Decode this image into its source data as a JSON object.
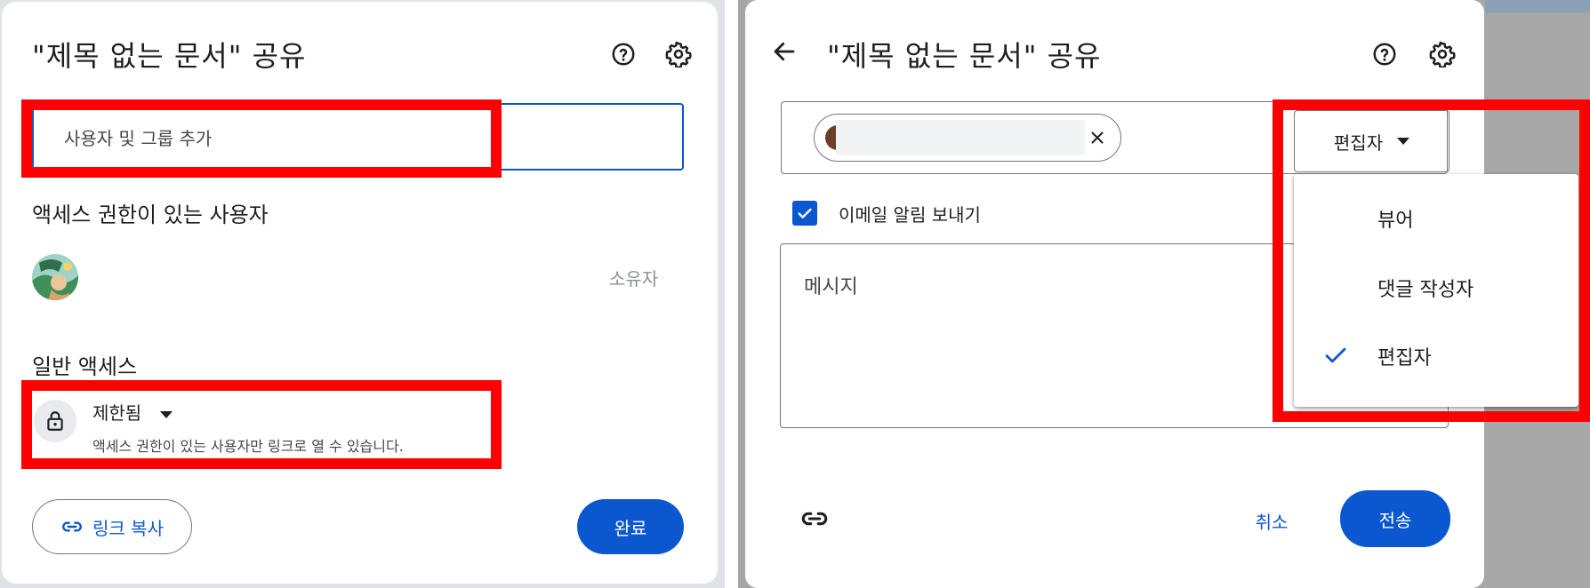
{
  "left_dialog": {
    "title": "\"제목 없는 문서\" 공유",
    "help_icon": "help-icon",
    "settings_icon": "gear-icon",
    "add_people_placeholder": "사용자 및 그룹 추가",
    "people_with_access_label": "액세스 권한이 있는 사용자",
    "owner": {
      "role": "소유자"
    },
    "general_access_label": "일반 액세스",
    "general_access": {
      "value": "제한됨",
      "description": "액세스 권한이 있는 사용자만 링크로 열 수 있습니다."
    },
    "copy_link_label": "링크 복사",
    "done_label": "완료"
  },
  "right_dialog": {
    "title": "\"제목 없는 문서\" 공유",
    "back_icon": "arrow-left-icon",
    "role_selected": "편집자",
    "notify_checkbox": {
      "label": "이메일 알림 보내기",
      "checked": true
    },
    "message_placeholder": "메시지",
    "role_menu": [
      {
        "label": "뷰어",
        "selected": false
      },
      {
        "label": "댓글 작성자",
        "selected": false
      },
      {
        "label": "편집자",
        "selected": true
      }
    ],
    "cancel_label": "취소",
    "send_label": "전송"
  },
  "colors": {
    "primary": "#0b57d0",
    "highlight": "#ff0000"
  }
}
